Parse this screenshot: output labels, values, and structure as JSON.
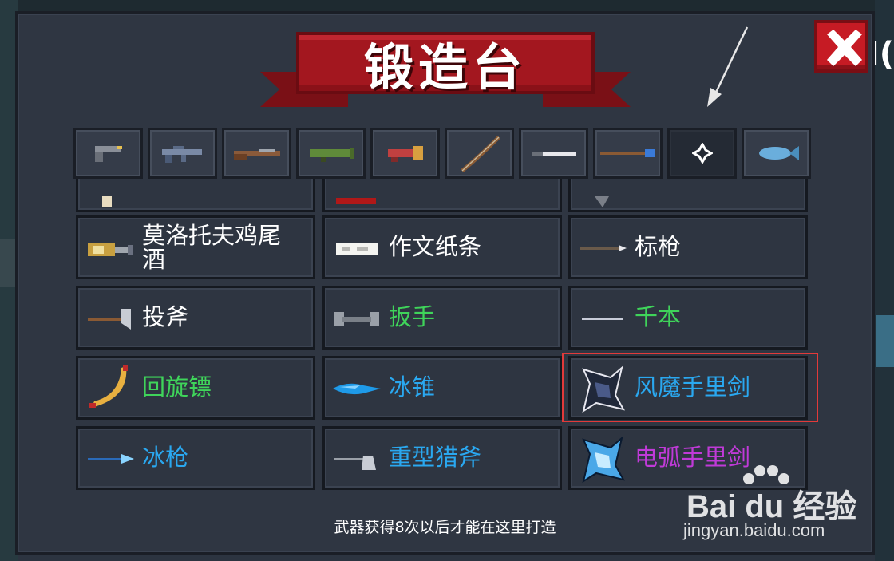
{
  "title": "锻造台",
  "footer_note": "武器获得8次以后才能在这里打造",
  "edge_text": "I(",
  "tabs": [
    {
      "icon": "pistol-icon",
      "active": false
    },
    {
      "icon": "rifle-icon",
      "active": false
    },
    {
      "icon": "shotgun-icon",
      "active": false
    },
    {
      "icon": "rocket-launcher-icon",
      "active": false
    },
    {
      "icon": "laser-gun-icon",
      "active": false
    },
    {
      "icon": "bow-icon",
      "active": false
    },
    {
      "icon": "sword-icon",
      "active": false
    },
    {
      "icon": "staff-icon",
      "active": false
    },
    {
      "icon": "throwing-weapon-icon",
      "active": true
    },
    {
      "icon": "fish-icon",
      "active": false
    }
  ],
  "partial_row": [
    "",
    "",
    ""
  ],
  "weapons": [
    {
      "name": "莫洛托夫鸡尾酒",
      "name_line1": "莫洛托夫鸡尾",
      "name_line2": "酒",
      "color": "#ffffff",
      "icon": "molotov-icon"
    },
    {
      "name": "作文纸条",
      "color": "#ffffff",
      "icon": "paper-note-icon"
    },
    {
      "name": "标枪",
      "color": "#ffffff",
      "icon": "javelin-icon"
    },
    {
      "name": "投斧",
      "color": "#ffffff",
      "icon": "throwing-axe-icon"
    },
    {
      "name": "扳手",
      "color": "#3fd45a",
      "icon": "wrench-icon"
    },
    {
      "name": "千本",
      "color": "#3fd45a",
      "icon": "senbon-icon"
    },
    {
      "name": "回旋镖",
      "color": "#3fd45a",
      "icon": "boomerang-icon"
    },
    {
      "name": "冰锥",
      "color": "#2aa8f0",
      "icon": "icicle-icon"
    },
    {
      "name": "风魔手里剑",
      "color": "#2aa8f0",
      "icon": "shuriken-icon",
      "highlighted": true
    },
    {
      "name": "冰枪",
      "color": "#2aa8f0",
      "icon": "ice-spear-icon"
    },
    {
      "name": "重型猎斧",
      "color": "#2aa8f0",
      "icon": "heavy-axe-icon"
    },
    {
      "name": "电弧手里剑",
      "color": "#c03ad8",
      "icon": "arc-shuriken-icon"
    }
  ],
  "watermark": {
    "brand": "Bai du 经验",
    "site": "jingyan.baidu.com"
  }
}
